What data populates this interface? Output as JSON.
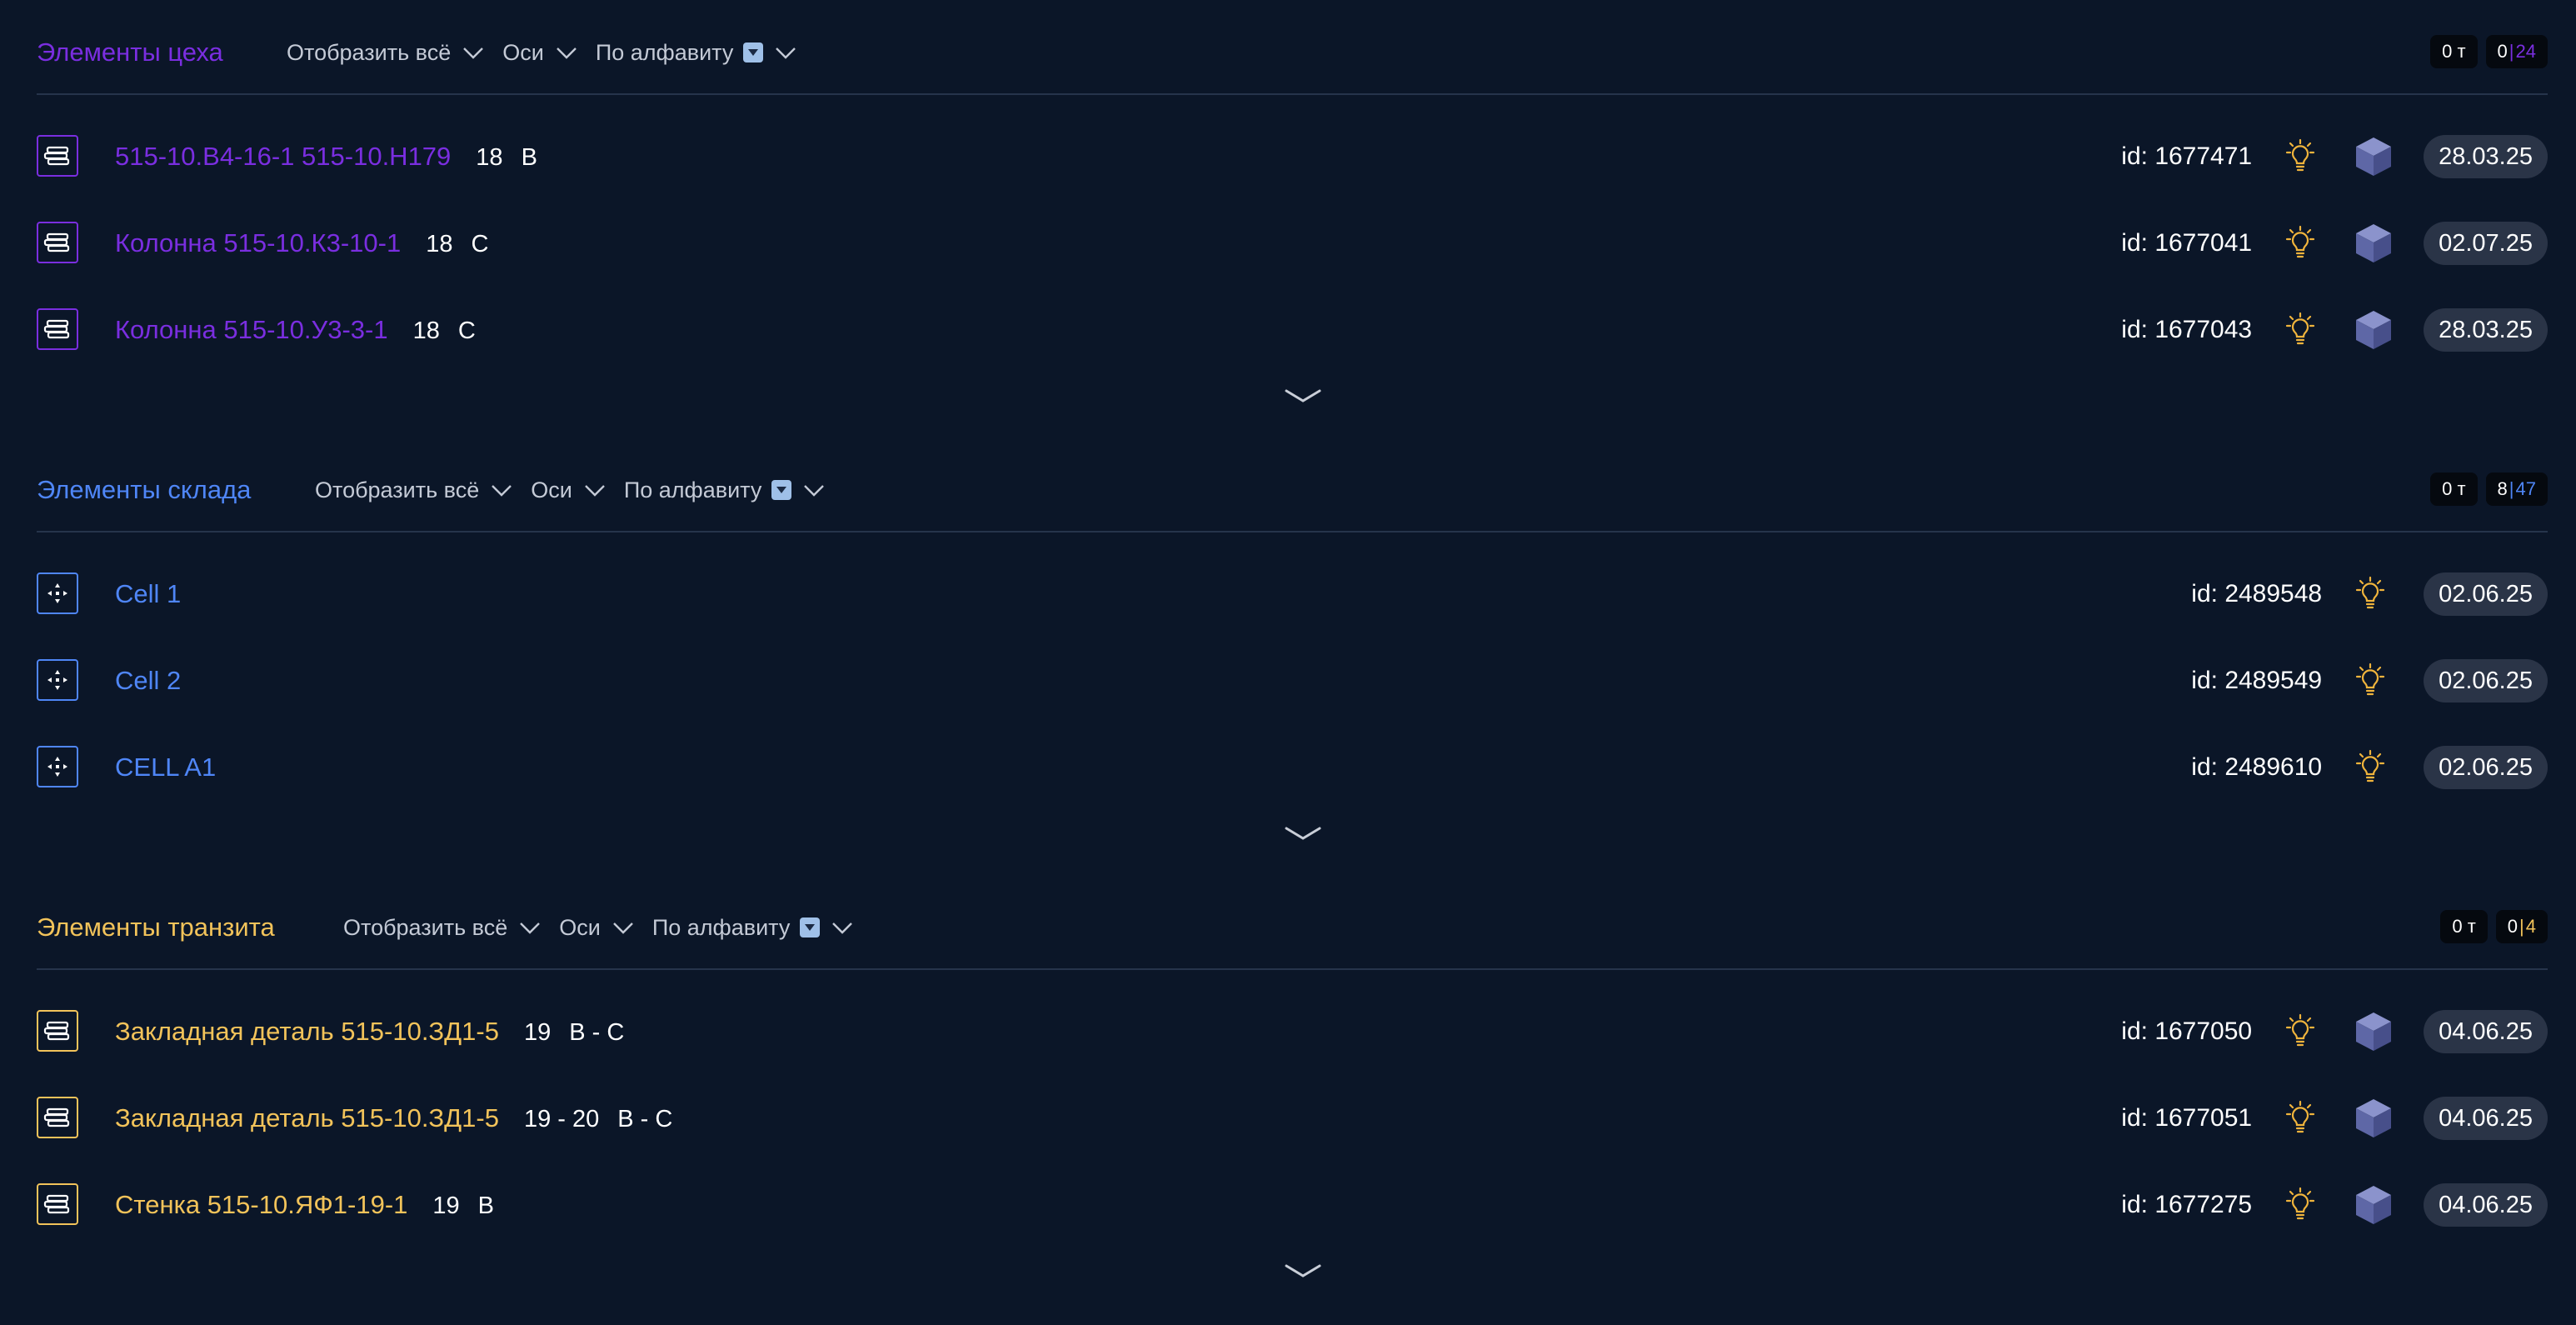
{
  "colors": {
    "workshop": "#7a2ee0",
    "warehouse": "#4f86f7",
    "transit": "#f2c35a",
    "background": "#0b1628"
  },
  "sections": [
    {
      "title": "Элементы цеха",
      "controls": {
        "show_all": "Отобразить всё",
        "axes": "Оси",
        "sort": "По алфавиту"
      },
      "weight": "0 т",
      "count_current": "0",
      "count_sep": "|",
      "count_total": "24",
      "rows": [
        {
          "icon": "stack-icon",
          "name": "515-10.В4-16-1 515-10.Н179",
          "axis_num": "18",
          "axis_letter": "В",
          "id": "id: 1677471",
          "has_cube": true,
          "date": "28.03.25"
        },
        {
          "icon": "stack-icon",
          "name": "Колонна 515-10.К3-10-1",
          "axis_num": "18",
          "axis_letter": "С",
          "id": "id: 1677041",
          "has_cube": true,
          "date": "02.07.25"
        },
        {
          "icon": "stack-icon",
          "name": "Колонна 515-10.У3-3-1",
          "axis_num": "18",
          "axis_letter": "С",
          "id": "id: 1677043",
          "has_cube": true,
          "date": "28.03.25"
        }
      ]
    },
    {
      "title": "Элементы склада",
      "controls": {
        "show_all": "Отобразить всё",
        "axes": "Оси",
        "sort": "По алфавиту"
      },
      "weight": "0 т",
      "count_current": "8",
      "count_sep": "|",
      "count_total": "47",
      "rows": [
        {
          "icon": "cell-icon",
          "name": "Cell 1",
          "axis_num": "",
          "axis_letter": "",
          "id": "id: 2489548",
          "has_cube": false,
          "date": "02.06.25"
        },
        {
          "icon": "cell-icon",
          "name": "Cell 2",
          "axis_num": "",
          "axis_letter": "",
          "id": "id: 2489549",
          "has_cube": false,
          "date": "02.06.25"
        },
        {
          "icon": "cell-icon",
          "name": "CELL A1",
          "axis_num": "",
          "axis_letter": "",
          "id": "id: 2489610",
          "has_cube": false,
          "date": "02.06.25"
        }
      ]
    },
    {
      "title": "Элементы транзита",
      "controls": {
        "show_all": "Отобразить всё",
        "axes": "Оси",
        "sort": "По алфавиту"
      },
      "weight": "0 т",
      "count_current": "0",
      "count_sep": "|",
      "count_total": "4",
      "rows": [
        {
          "icon": "stack-icon",
          "name": "Закладная деталь 515-10.ЗД1-5",
          "axis_num": "19",
          "axis_letter": "В - С",
          "id": "id: 1677050",
          "has_cube": true,
          "date": "04.06.25"
        },
        {
          "icon": "stack-icon",
          "name": "Закладная деталь 515-10.ЗД1-5",
          "axis_num": "19 - 20",
          "axis_letter": "В - С",
          "id": "id: 1677051",
          "has_cube": true,
          "date": "04.06.25"
        },
        {
          "icon": "stack-icon",
          "name": "Стенка 515-10.ЯФ1-19-1",
          "axis_num": "19",
          "axis_letter": "В",
          "id": "id: 1677275",
          "has_cube": true,
          "date": "04.06.25"
        }
      ]
    }
  ]
}
